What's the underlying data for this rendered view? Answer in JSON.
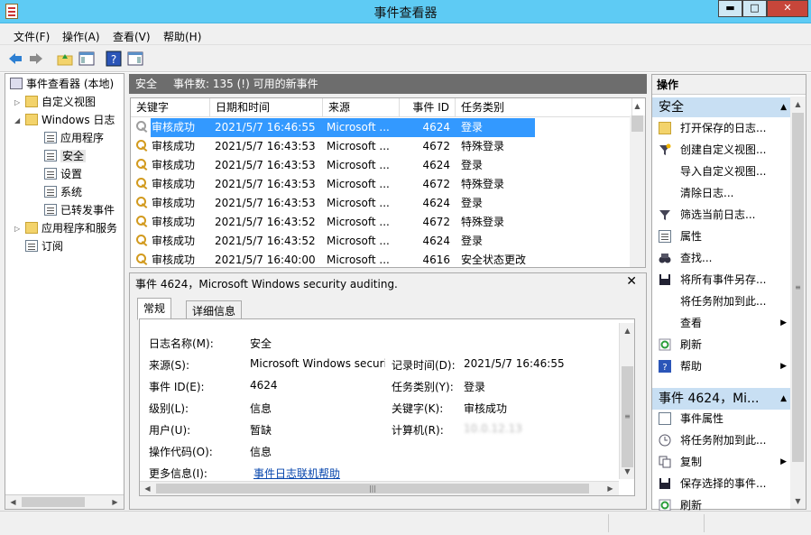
{
  "window": {
    "title": "事件查看器",
    "min": "▬",
    "max": "□",
    "close": "✕"
  },
  "menu": [
    "文件(F)",
    "操作(A)",
    "查看(V)",
    "帮助(H)"
  ],
  "tree": {
    "root": "事件查看器 (本地)",
    "custom_views": "自定义视图",
    "windows_logs": "Windows 日志",
    "application": "应用程序",
    "security": "安全",
    "setup": "设置",
    "system": "系统",
    "forwarded": "已转发事件",
    "apps_services": "应用程序和服务",
    "subscriptions": "订阅"
  },
  "log_header": {
    "name": "安全",
    "count": "事件数: 135 (!) 可用的新事件"
  },
  "columns": [
    "关键字",
    "日期和时间",
    "来源",
    "事件 ID",
    "任务类别"
  ],
  "rows": [
    [
      "审核成功",
      "2021/5/7 16:46:55",
      "Microsoft ...",
      "4624",
      "登录"
    ],
    [
      "审核成功",
      "2021/5/7 16:43:53",
      "Microsoft ...",
      "4672",
      "特殊登录"
    ],
    [
      "审核成功",
      "2021/5/7 16:43:53",
      "Microsoft ...",
      "4624",
      "登录"
    ],
    [
      "审核成功",
      "2021/5/7 16:43:53",
      "Microsoft ...",
      "4672",
      "特殊登录"
    ],
    [
      "审核成功",
      "2021/5/7 16:43:53",
      "Microsoft ...",
      "4624",
      "登录"
    ],
    [
      "审核成功",
      "2021/5/7 16:43:52",
      "Microsoft ...",
      "4672",
      "特殊登录"
    ],
    [
      "审核成功",
      "2021/5/7 16:43:52",
      "Microsoft ...",
      "4624",
      "登录"
    ],
    [
      "审核成功",
      "2021/5/7 16:40:00",
      "Microsoft ...",
      "4616",
      "安全状态更改"
    ]
  ],
  "detail": {
    "title": "事件 4624，Microsoft Windows security auditing.",
    "close": "✕",
    "tab_general": "常规",
    "tab_detail": "详细信息",
    "log_name_label": "日志名称(M):",
    "log_name": "安全",
    "source_label": "来源(S):",
    "source": "Microsoft Windows security",
    "logged_label": "记录时间(D):",
    "logged": "2021/5/7 16:46:55",
    "event_id_label": "事件 ID(E):",
    "event_id": "4624",
    "task_label": "任务类别(Y):",
    "task": "登录",
    "level_label": "级别(L):",
    "level": "信息",
    "keywords_label": "关键字(K):",
    "keywords": "审核成功",
    "user_label": "用户(U):",
    "user": "暂缺",
    "computer_label": "计算机(R):",
    "computer": "10.0.12.13",
    "opcode_label": "操作代码(O):",
    "opcode": "信息",
    "more_label": "更多信息(I):",
    "more_link": "事件日志联机帮助"
  },
  "actions": {
    "header": "操作",
    "section1": "安全",
    "items1": [
      "打开保存的日志...",
      "创建自定义视图...",
      "导入自定义视图...",
      "清除日志...",
      "筛选当前日志...",
      "属性",
      "查找...",
      "将所有事件另存...",
      "将任务附加到此...",
      "查看",
      "刷新",
      "帮助"
    ],
    "section2": "事件 4624，Mi...",
    "items2": [
      "事件属性",
      "将任务附加到此...",
      "复制",
      "保存选择的事件...",
      "刷新"
    ]
  },
  "colors": {
    "titlebar": "#5ecbf4",
    "selection": "#3399ff",
    "section": "#c8dff3",
    "link": "#0645ad"
  }
}
